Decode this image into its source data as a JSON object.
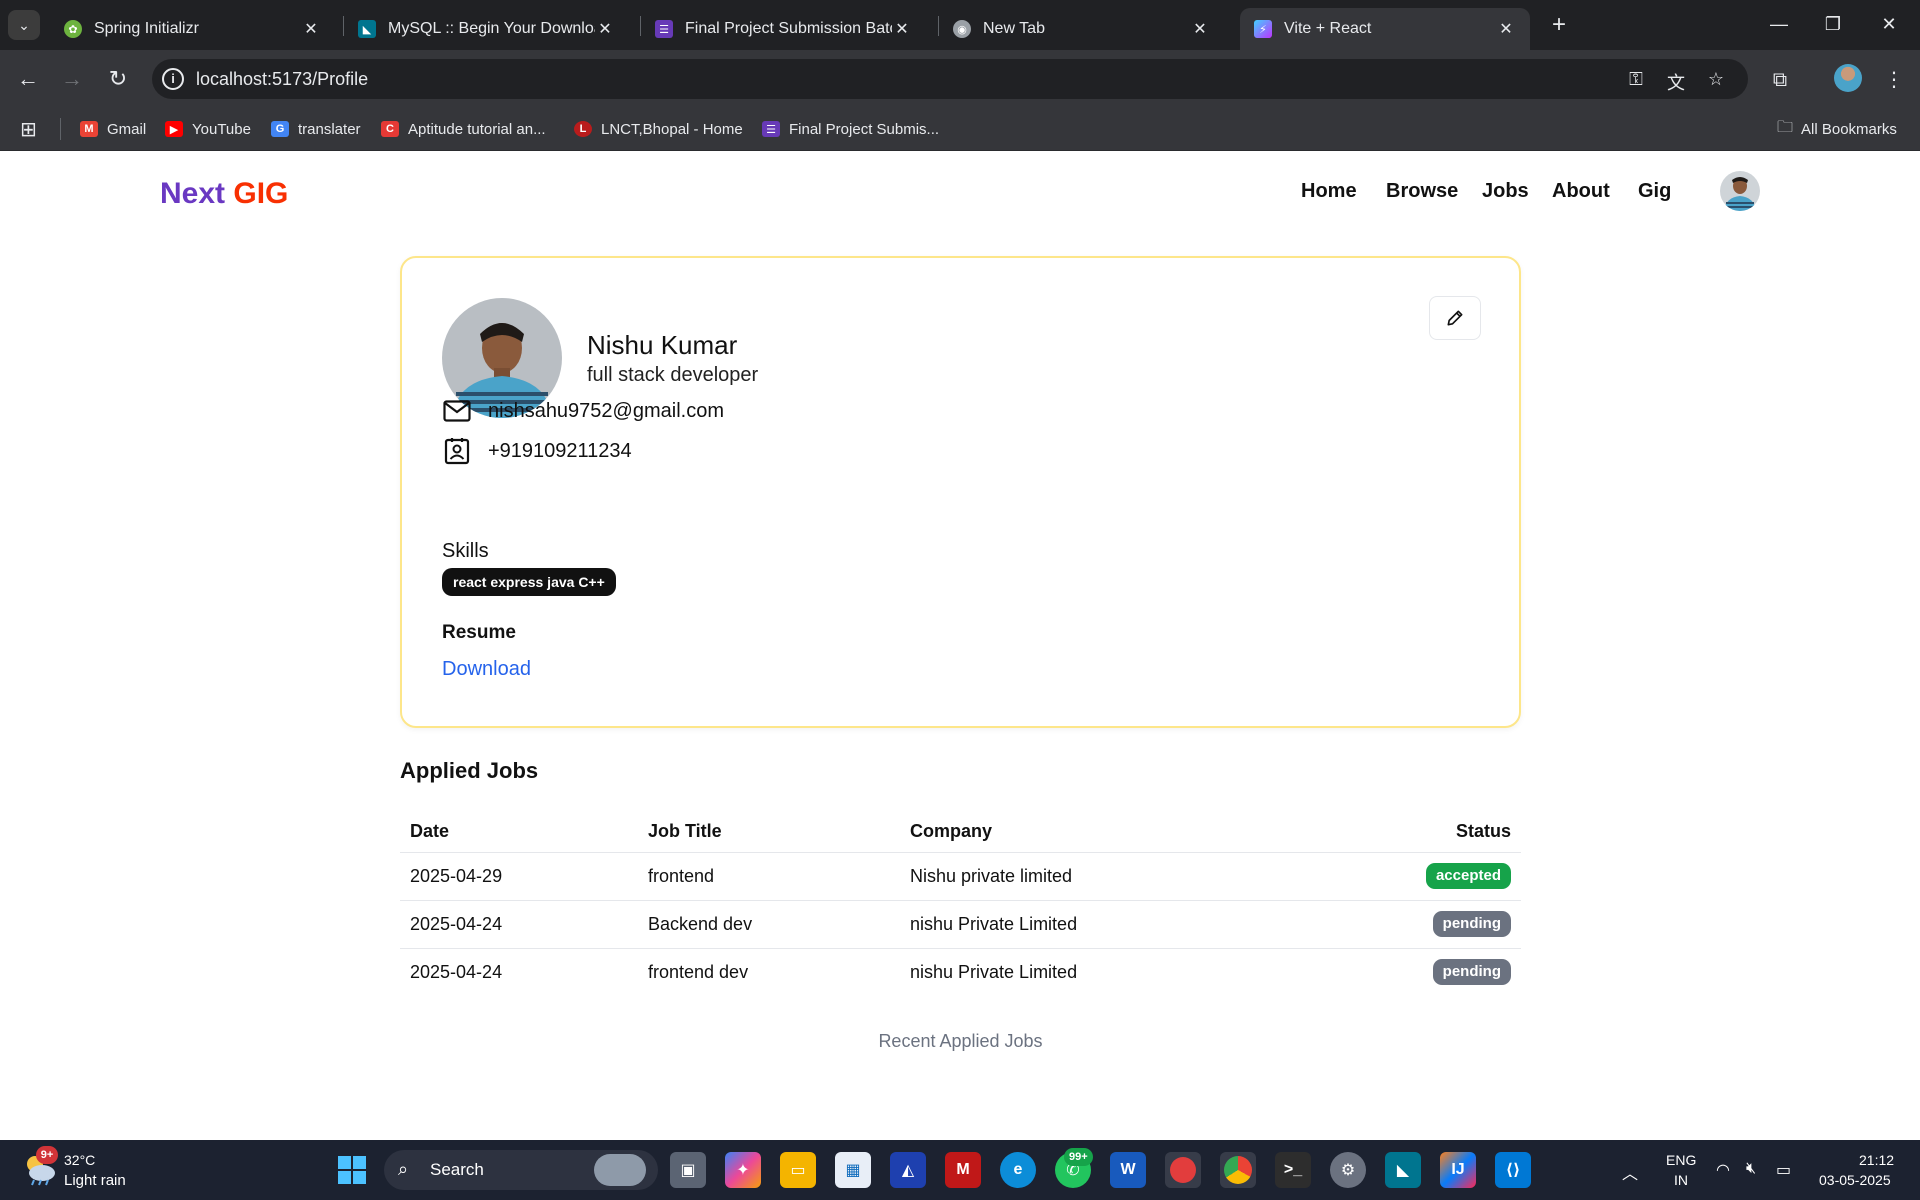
{
  "browser": {
    "tabs": [
      {
        "title": "Spring Initializr",
        "favicon": "spring-icon",
        "color": "#6db33f",
        "active": false
      },
      {
        "title": "MySQL :: Begin Your Download",
        "favicon": "mysql-icon",
        "color": "#00758f",
        "active": false
      },
      {
        "title": "Final Project Submission Batch(",
        "favicon": "form-icon",
        "color": "#673ab7",
        "active": false
      },
      {
        "title": "New Tab",
        "favicon": "chrome-icon",
        "color": "#9aa0a6",
        "active": false
      },
      {
        "title": "Vite + React",
        "favicon": "vite-icon",
        "color": "#a855f7",
        "active": true
      }
    ],
    "url": "localhost:5173/Profile",
    "bookmarks": [
      {
        "label": "Gmail",
        "icon": "gmail-icon",
        "color": "#ea4335"
      },
      {
        "label": "YouTube",
        "icon": "youtube-icon",
        "color": "#ff0000"
      },
      {
        "label": "translater",
        "icon": "translate-icon",
        "color": "#4285f4"
      },
      {
        "label": "Aptitude tutorial an...",
        "icon": "c-icon",
        "color": "#e53935"
      },
      {
        "label": "LNCT,Bhopal - Home",
        "icon": "lnct-icon",
        "color": "#b91c1c"
      },
      {
        "label": "Final Project Submis...",
        "icon": "form-icon",
        "color": "#673ab7"
      }
    ],
    "all_bookmarks": "All Bookmarks"
  },
  "navbar": {
    "brand_part1": "Next",
    "brand_part2": "GIG",
    "links": [
      "Home",
      "Browse",
      "Jobs",
      "About",
      "Gig"
    ]
  },
  "profile": {
    "name": "Nishu Kumar",
    "bio": "full stack developer",
    "email": "nishsahu9752@gmail.com",
    "phone": "+919109211234",
    "skills_label": "Skills",
    "skills": "react express java C++",
    "resume_label": "Resume",
    "resume_link": "Download"
  },
  "applied_jobs": {
    "title": "Applied Jobs",
    "columns": [
      "Date",
      "Job Title",
      "Company",
      "Status"
    ],
    "rows": [
      {
        "date": "2025-04-29",
        "job_title": "frontend",
        "company": "Nishu private limited",
        "status": "accepted",
        "status_color": "#16a34a"
      },
      {
        "date": "2025-04-24",
        "job_title": "Backend dev",
        "company": "nishu Private Limited",
        "status": "pending",
        "status_color": "#6b7280"
      },
      {
        "date": "2025-04-24",
        "job_title": "frontend dev",
        "company": "nishu Private Limited",
        "status": "pending",
        "status_color": "#6b7280"
      }
    ],
    "caption": "Recent Applied Jobs"
  },
  "taskbar": {
    "weather_badge": "9+",
    "temperature": "32°C",
    "weather": "Light rain",
    "search_placeholder": "Search",
    "whatsapp_badge": "99+",
    "lang_line1": "ENG",
    "lang_line2": "IN",
    "time": "21:12",
    "date": "03-05-2025"
  },
  "colors": {
    "brand_purple": "#6a38c2",
    "brand_orange": "#f83002",
    "card_border": "#fde68a",
    "link_blue": "#2563eb"
  }
}
